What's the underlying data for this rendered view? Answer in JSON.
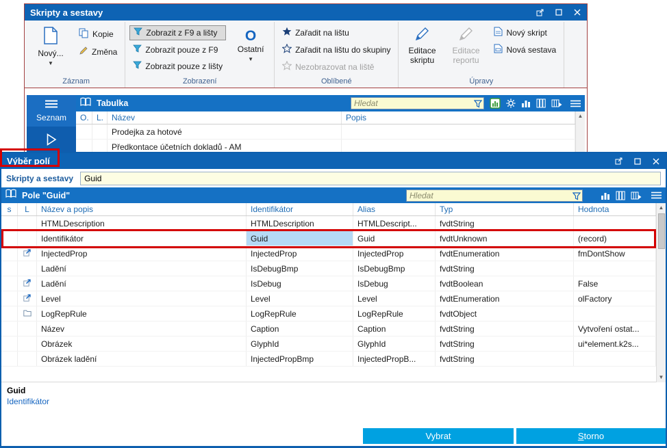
{
  "main_window": {
    "title": "Skripty a sestavy",
    "ribbon": {
      "zaznam": {
        "label": "Záznam",
        "novy": "Nový...",
        "kopie": "Kopie",
        "zmena": "Změna"
      },
      "zobrazeni": {
        "label": "Zobrazení",
        "f9_a_listy": "Zobrazit z F9 a lišty",
        "pouze_f9": "Zobrazit pouze z F9",
        "pouze_listy": "Zobrazit pouze z lišty",
        "ostatni": "Ostatní"
      },
      "oblibene": {
        "label": "Oblíbené",
        "zaradit": "Zařadit na lištu",
        "zaradit_skupina": "Zařadit na lištu do skupiny",
        "nezobrazovat": "Nezobrazovat na liště"
      },
      "upravy": {
        "label": "Úpravy",
        "editace_skriptu": "Editace skriptu",
        "editace_reportu": "Editace reportu",
        "novy_skript": "Nový skript",
        "nova_sestava": "Nová sestava"
      }
    },
    "sidebar": {
      "seznam": "Seznam"
    },
    "table": {
      "title": "Tabulka",
      "search_placeholder": "Hledat",
      "columns": {
        "o": "O.",
        "l": "L.",
        "nazev": "Název",
        "popis": "Popis"
      },
      "rows": [
        {
          "nazev": "Prodejka za hotové"
        },
        {
          "nazev": "Předkontace účetních dokladů - AM"
        }
      ]
    }
  },
  "dialog": {
    "title": "Výběr polí",
    "context_label": "Skripty a sestavy",
    "context_value": "Guid",
    "table": {
      "title": "Pole \"Guid\"",
      "search_placeholder": "Hledat",
      "columns": {
        "s": "s",
        "l": "L",
        "name": "Název a popis",
        "id": "Identifikátor",
        "alias": "Alias",
        "typ": "Typ",
        "value": "Hodnota"
      },
      "rows": [
        {
          "name": "HTMLDescription",
          "id": "HTMLDescription",
          "alias": "HTMLDescript...",
          "typ": "fvdtString",
          "value": ""
        },
        {
          "name": "Identifikátor",
          "id": "Guid",
          "alias": "Guid",
          "typ": "fvdtUnknown",
          "value": "(record)"
        },
        {
          "name": "InjectedProp",
          "id": "InjectedProp",
          "alias": "InjectedProp",
          "typ": "fvdtEnumeration",
          "value": "fmDontShow"
        },
        {
          "name": "Ladění",
          "id": "IsDebugBmp",
          "alias": "IsDebugBmp",
          "typ": "fvdtString",
          "value": ""
        },
        {
          "name": "Ladění",
          "id": "IsDebug",
          "alias": "IsDebug",
          "typ": "fvdtBoolean",
          "value": "False"
        },
        {
          "name": "Level",
          "id": "Level",
          "alias": "Level",
          "typ": "fvdtEnumeration",
          "value": "olFactory"
        },
        {
          "name": "LogRepRule",
          "id": "LogRepRule",
          "alias": "LogRepRule",
          "typ": "fvdtObject",
          "value": ""
        },
        {
          "name": "Název",
          "id": "Caption",
          "alias": "Caption",
          "typ": "fvdtString",
          "value": "Vytvoření ostat..."
        },
        {
          "name": "Obrázek",
          "id": "GlyphId",
          "alias": "GlyphId",
          "typ": "fvdtString",
          "value": "ui*element.k2s..."
        },
        {
          "name": "Obrázek ladění",
          "id": "InjectedPropBmp",
          "alias": "InjectedPropB...",
          "typ": "fvdtString",
          "value": ""
        }
      ]
    },
    "detail": {
      "name": "Guid",
      "description": "Identifikátor"
    },
    "buttons": {
      "select": "Vybrat",
      "cancel": "Storno"
    }
  }
}
